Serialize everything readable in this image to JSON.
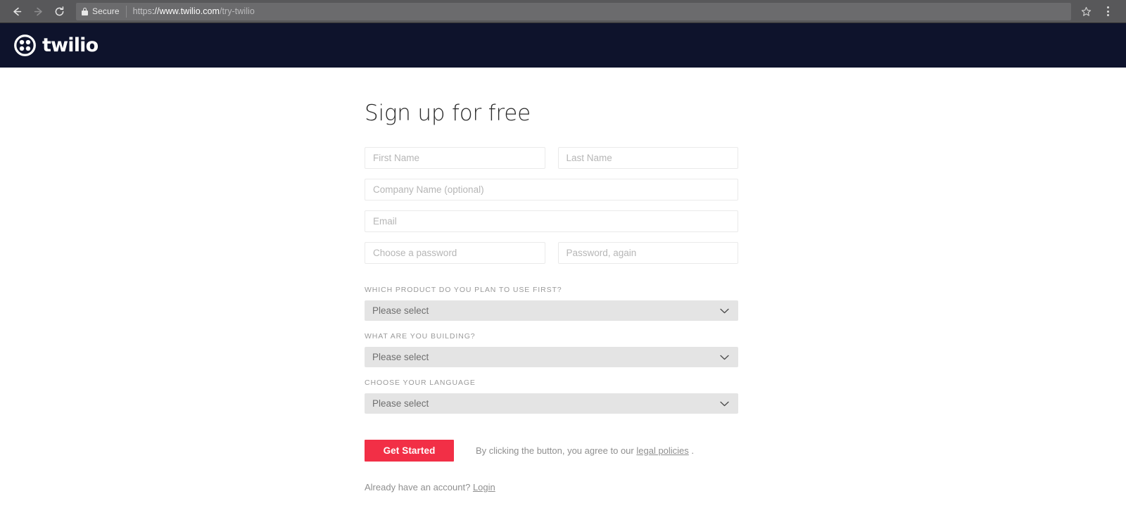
{
  "browser": {
    "back_icon": "arrow-left-icon",
    "forward_icon": "arrow-right-icon",
    "reload_icon": "reload-icon",
    "security_label": "Secure",
    "lock_icon": "lock-icon",
    "url_scheme": "https",
    "url_host": "://www.twilio.com",
    "url_path": "/try-twilio",
    "url_full": "https://www.twilio.com/try-twilio",
    "bookmark_icon": "star-icon",
    "menu_icon": "three-dots-menu-icon",
    "toolbar_bg": "#58585a",
    "omnibox_bg": "#6b6b6d"
  },
  "site_header": {
    "logo_text": "twilio",
    "logo_mark": "twilio-circle-dots-icon",
    "background": "#0e132c"
  },
  "form": {
    "title": "Sign up for free",
    "fields": {
      "first_name_placeholder": "First Name",
      "last_name_placeholder": "Last Name",
      "company_placeholder": "Company Name (optional)",
      "email_placeholder": "Email",
      "password_placeholder": "Choose a password",
      "password_confirm_placeholder": "Password, again"
    },
    "selects": [
      {
        "label": "WHICH PRODUCT DO YOU PLAN TO USE FIRST?",
        "value": "Please select",
        "chevron_icon": "chevron-down-icon"
      },
      {
        "label": "WHAT ARE YOU BUILDING?",
        "value": "Please select",
        "chevron_icon": "chevron-down-icon"
      },
      {
        "label": "CHOOSE YOUR LANGUAGE",
        "value": "Please select",
        "chevron_icon": "chevron-down-icon"
      }
    ],
    "submit_label": "Get Started",
    "legal_prefix": "By clicking the button, you agree to our ",
    "legal_link": "legal policies",
    "legal_suffix": " .",
    "login_prefix": "Already have an account? ",
    "login_link": "Login"
  },
  "colors": {
    "brand_red": "#f22f46",
    "header_navy": "#0e132c",
    "select_gray": "#e4e4e4",
    "input_border": "#eaeaea",
    "placeholder_gray": "#b6b6b6",
    "label_gray": "#9a9a9a"
  }
}
